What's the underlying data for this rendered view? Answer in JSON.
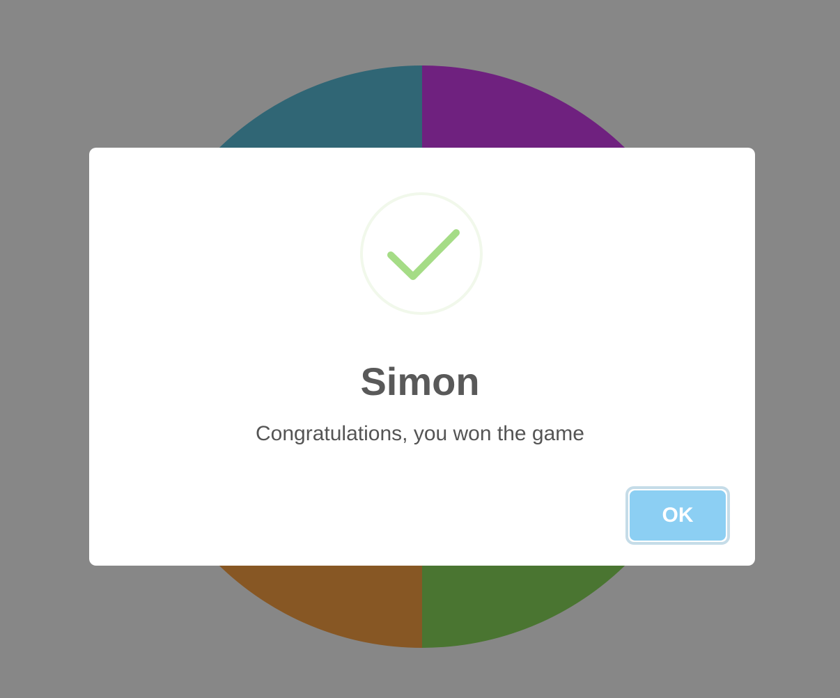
{
  "board": {
    "colors": {
      "top_left": "#5bc0de",
      "top_right": "#d23ff0",
      "bottom_left": "#ffa544",
      "bottom_right": "#8dde5e"
    }
  },
  "dialog": {
    "icon": "success-check-icon",
    "icon_color": "#a5dc86",
    "title": "Simon",
    "text": "Congratulations, you won the game",
    "confirm_label": "OK",
    "confirm_color": "#8ccff3"
  }
}
